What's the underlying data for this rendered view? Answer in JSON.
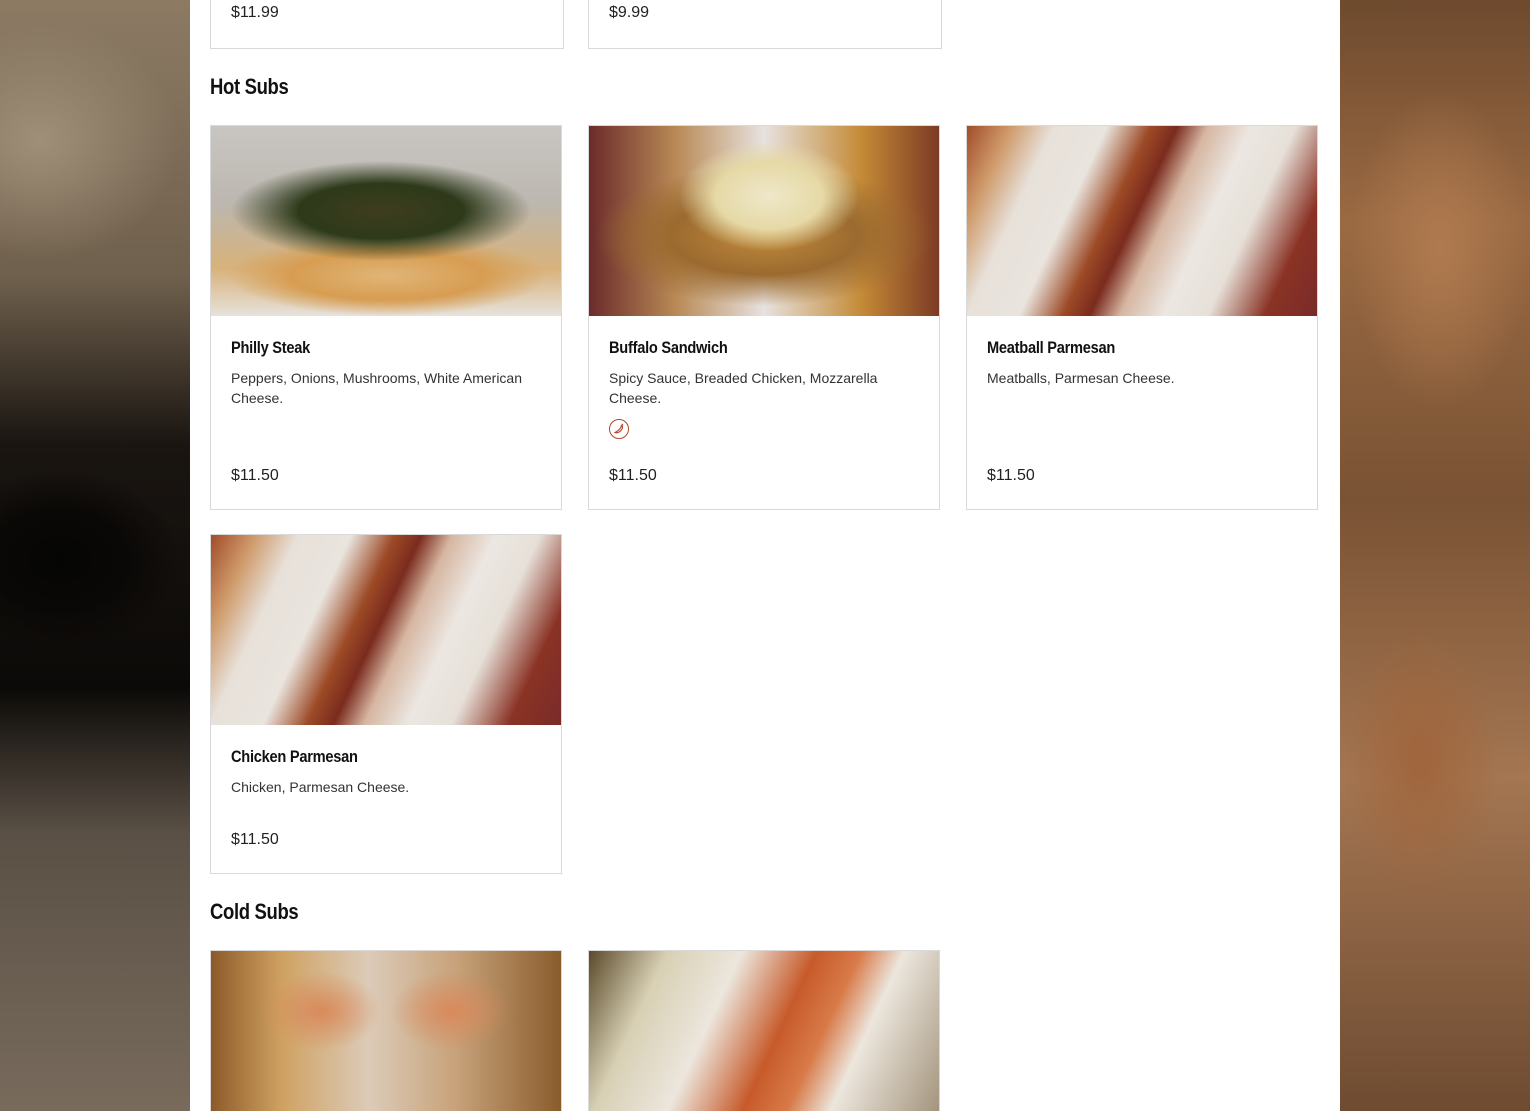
{
  "top_cards": [
    {
      "price": "$11.99"
    },
    {
      "price": "$9.99"
    }
  ],
  "sections": [
    {
      "title": "Hot Subs",
      "items": [
        {
          "name": "Philly Steak",
          "description": "Peppers, Onions, Mushrooms, White American Cheese.",
          "price": "$11.50",
          "spicy": false
        },
        {
          "name": "Buffalo Sandwich",
          "description": "Spicy Sauce, Breaded Chicken, Mozzarella Cheese.",
          "price": "$11.50",
          "spicy": true
        },
        {
          "name": "Meatball Parmesan",
          "description": "Meatballs, Parmesan Cheese.",
          "price": "$11.50",
          "spicy": false
        },
        {
          "name": "Chicken Parmesan",
          "description": "Chicken, Parmesan Cheese.",
          "price": "$11.50",
          "spicy": false
        }
      ]
    },
    {
      "title": "Cold Subs",
      "items": []
    }
  ],
  "icons": {
    "spicy": "chili-pepper-icon"
  },
  "colors": {
    "spicy": "#b4452b",
    "card_border": "#d9d9d9",
    "panel": "#ffffff"
  }
}
